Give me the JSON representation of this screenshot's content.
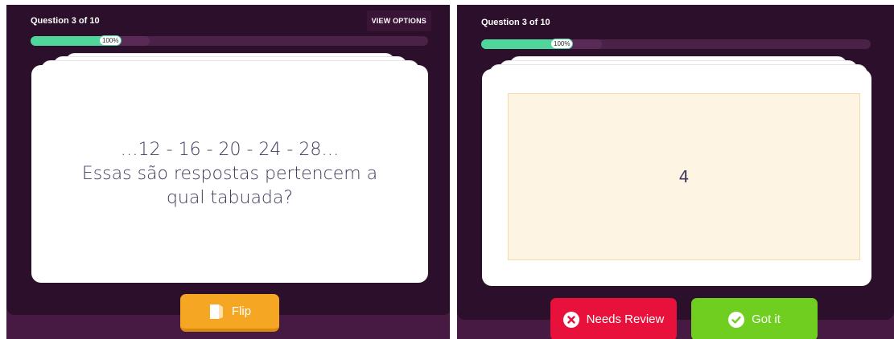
{
  "front": {
    "question_counter": "Question 3 of 10",
    "view_options_label": "VIEW OPTIONS",
    "progress": {
      "label": "100%",
      "percent": 100
    },
    "question_lines": [
      "…12 - 16 - 20 - 24 - 28…",
      "Essas são respostas pertencem a",
      "qual tabuada?"
    ],
    "flip_label": "Flip"
  },
  "back": {
    "question_counter": "Question 3 of 10",
    "progress": {
      "label": "100%",
      "percent": 100
    },
    "answer": "4",
    "needs_review_label": "Needs Review",
    "got_it_label": "Got it"
  },
  "colors": {
    "background": "#461a42",
    "progress_fill": "#4fd69b",
    "flip_button": "#f5a623",
    "needs_review_button": "#e7113c",
    "got_it_button": "#6fce1f",
    "answer_box": "#fdf4e3"
  },
  "icons": {
    "flip": "card-flip-icon",
    "needs_review": "x-circle-icon",
    "got_it": "check-circle-icon"
  }
}
